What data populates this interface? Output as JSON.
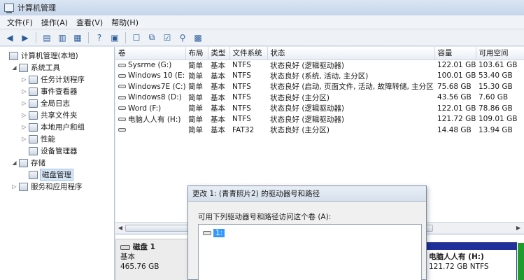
{
  "window": {
    "title": "计算机管理"
  },
  "menu": [
    "文件(F)",
    "操作(A)",
    "查看(V)",
    "帮助(H)"
  ],
  "toolbar": [
    "back-arrow-icon",
    "forward-arrow-icon",
    "folder-up-icon",
    "show-tree-icon",
    "help-icon",
    "panel-icon",
    "properties-icon",
    "open-icon",
    "export-icon",
    "search-icon",
    "checklist-icon"
  ],
  "tree": [
    {
      "label": "计算机管理(本地)",
      "level": 0,
      "expander": "",
      "icon": "computer-icon"
    },
    {
      "label": "系统工具",
      "level": 1,
      "expander": "◢",
      "icon": "tools-icon"
    },
    {
      "label": "任务计划程序",
      "level": 2,
      "expander": "▷",
      "icon": "clock-icon"
    },
    {
      "label": "事件查看器",
      "level": 2,
      "expander": "▷",
      "icon": "event-viewer-icon"
    },
    {
      "label": "全局日志",
      "level": 2,
      "expander": "▷",
      "icon": "log-icon"
    },
    {
      "label": "共享文件夹",
      "level": 2,
      "expander": "▷",
      "icon": "shared-folder-icon"
    },
    {
      "label": "本地用户和组",
      "level": 2,
      "expander": "▷",
      "icon": "users-icon"
    },
    {
      "label": "性能",
      "level": 2,
      "expander": "▷",
      "icon": "performance-icon"
    },
    {
      "label": "设备管理器",
      "level": 2,
      "expander": "",
      "icon": "device-manager-icon"
    },
    {
      "label": "存储",
      "level": 1,
      "expander": "◢",
      "icon": "storage-icon"
    },
    {
      "label": "磁盘管理",
      "level": 2,
      "expander": "",
      "icon": "disk-management-icon",
      "selected": true
    },
    {
      "label": "服务和应用程序",
      "level": 1,
      "expander": "▷",
      "icon": "services-icon"
    }
  ],
  "volumes": {
    "headers": [
      "卷",
      "布局",
      "类型",
      "文件系统",
      "状态",
      "容量",
      "可用空间"
    ],
    "rows": [
      [
        "Sysrme (G:)",
        "简单",
        "基本",
        "NTFS",
        "状态良好 (逻辑驱动器)",
        "122.01 GB",
        "103.61 GB"
      ],
      [
        "Windows 10 (E:)",
        "简单",
        "基本",
        "NTFS",
        "状态良好 (系统, 活动, 主分区)",
        "100.01 GB",
        "53.40 GB"
      ],
      [
        "Windows7E (C:)",
        "简单",
        "基本",
        "NTFS",
        "状态良好 (启动, 页面文件, 活动, 故障转储, 主分区)",
        "75.68 GB",
        "15.30 GB"
      ],
      [
        "Windows8 (D:)",
        "简单",
        "基本",
        "NTFS",
        "状态良好 (主分区)",
        "43.56 GB",
        "7.60 GB"
      ],
      [
        "Word (F:)",
        "简单",
        "基本",
        "NTFS",
        "状态良好 (逻辑驱动器)",
        "122.01 GB",
        "78.86 GB"
      ],
      [
        "电脑人人有 (H:)",
        "简单",
        "基本",
        "NTFS",
        "状态良好 (逻辑驱动器)",
        "121.72 GB",
        "109.01 GB"
      ],
      [
        "",
        "简单",
        "基本",
        "FAT32",
        "状态良好 (主分区)",
        "14.48 GB",
        "13.94 GB"
      ]
    ]
  },
  "disk": {
    "name": "磁盘 1",
    "type": "基本",
    "size": "465.76 GB"
  },
  "partition_h": {
    "name": "电脑人人有 (H:)",
    "detail": "121.72 GB NTFS"
  },
  "dialog": {
    "title": "更改 1: (青青照片2) 的驱动器号和路径",
    "prompt": "可用下列驱动器号和路径访问这个卷 (A):",
    "entry": "1:"
  },
  "colors": {
    "selection": "#3399ff",
    "partition_bar": "#1f2f9c",
    "titlebar": "#c5d5ea"
  }
}
